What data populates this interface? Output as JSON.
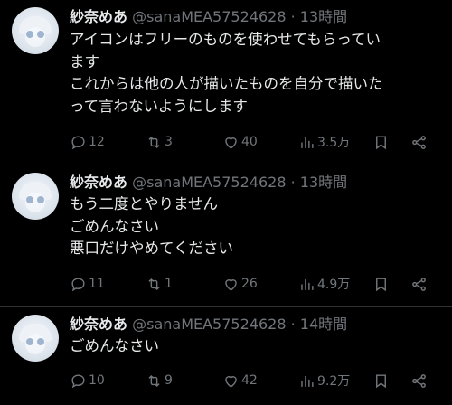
{
  "tweets": [
    {
      "display_name": "紗奈めあ",
      "handle": "@sanaMEA57524628",
      "separator": "·",
      "time": "13時間",
      "lines": [
        "アイコンはフリーのものを使わせてもらってい",
        "ます",
        "これからは他の人が描いたものを自分で描いた",
        "って言わないようにします"
      ],
      "replies": "12",
      "retweets": "3",
      "likes": "40",
      "views": "3.5万"
    },
    {
      "display_name": "紗奈めあ",
      "handle": "@sanaMEA57524628",
      "separator": "·",
      "time": "13時間",
      "lines": [
        "もう二度とやりません",
        "ごめんなさい",
        "悪口だけやめてください"
      ],
      "replies": "11",
      "retweets": "1",
      "likes": "26",
      "views": "4.9万"
    },
    {
      "display_name": "紗奈めあ",
      "handle": "@sanaMEA57524628",
      "separator": "·",
      "time": "14時間",
      "lines": [
        "ごめんなさい"
      ],
      "replies": "10",
      "retweets": "9",
      "likes": "42",
      "views": "9.2万"
    }
  ],
  "icons": {
    "reply": "reply-icon",
    "retweet": "retweet-icon",
    "like": "heart-icon",
    "views": "views-icon",
    "bookmark": "bookmark-icon",
    "share": "share-icon"
  },
  "colors": {
    "background": "#000000",
    "text": "#e7e9ea",
    "secondary": "#71767b",
    "divider": "#2f3336"
  }
}
